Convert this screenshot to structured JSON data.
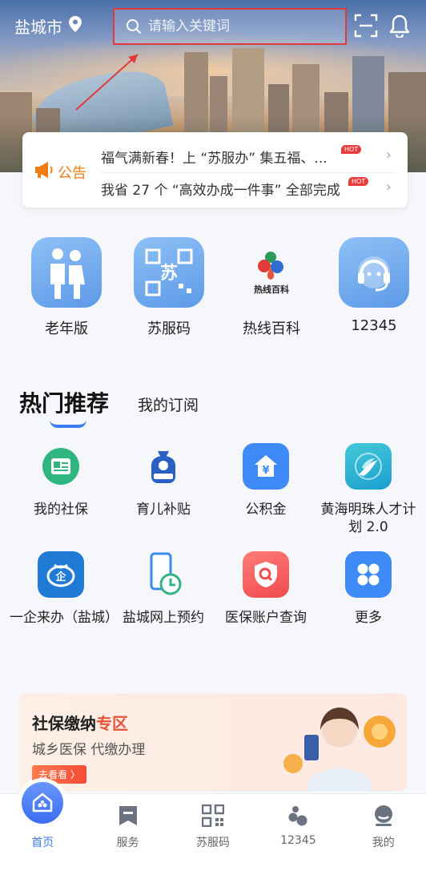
{
  "header": {
    "city": "盐城市",
    "search_placeholder": "请输入关键词"
  },
  "notice": {
    "tag": "公告",
    "items": [
      {
        "text": "福气满新春！上 “苏服办” 集五福、...",
        "badge": "HOT"
      },
      {
        "text": "我省 27 个 “高效办成一件事” 全部完成",
        "badge": "HOT"
      }
    ]
  },
  "quick_actions": [
    {
      "label": "老年版",
      "icon": "elderly-couple-icon"
    },
    {
      "label": "苏服码",
      "icon": "qr-code-icon"
    },
    {
      "label": "热线百科",
      "icon": "hotline-encyclopedia-icon"
    },
    {
      "label": "12345",
      "icon": "headset-icon"
    }
  ],
  "hotline_logo": {
    "title": "热线百科"
  },
  "recommend": {
    "tabs": [
      "热门推荐",
      "我的订阅"
    ]
  },
  "services_row1": [
    {
      "label": "我的社保",
      "icon": "social-security-icon"
    },
    {
      "label": "育儿补贴",
      "icon": "childcare-subsidy-icon"
    },
    {
      "label": "公积金",
      "icon": "housing-fund-icon"
    },
    {
      "label": "黄海明珠人才计划 2.0",
      "icon": "talent-plan-icon"
    }
  ],
  "services_row2": [
    {
      "label": "一企来办（盐城）",
      "icon": "enterprise-icon"
    },
    {
      "label": "盐城网上预约",
      "icon": "appointment-icon"
    },
    {
      "label": "医保账户查询",
      "icon": "medical-insurance-icon"
    },
    {
      "label": "更多",
      "icon": "more-grid-icon"
    }
  ],
  "banner": {
    "title_a": "社保缴纳",
    "title_b": "专区",
    "subtitle": "城乡医保 代缴办理",
    "button": "去看看 〉"
  },
  "tabbar": [
    {
      "label": "首页",
      "icon": "home-icon",
      "active": true
    },
    {
      "label": "服务",
      "icon": "service-icon",
      "active": false
    },
    {
      "label": "苏服码",
      "icon": "qr-code-icon",
      "active": false
    },
    {
      "label": "12345",
      "icon": "hotline-icon",
      "active": false
    },
    {
      "label": "我的",
      "icon": "profile-icon",
      "active": false
    }
  ],
  "colors": {
    "accent": "#3a7bf0",
    "notice": "#f07c12",
    "hot": "#e93b3b",
    "highlight_box": "#e23a3a"
  }
}
